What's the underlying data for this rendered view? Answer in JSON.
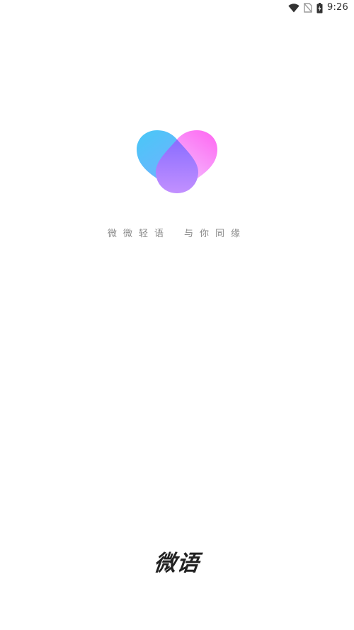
{
  "status_bar": {
    "time": "9:26",
    "icons": [
      "wifi-icon",
      "no-sim-icon",
      "battery-charging-icon"
    ]
  },
  "logo": {
    "icon": "heart-droplet-logo",
    "colors": {
      "left_drop_top": "#4ec6f5",
      "left_drop_bottom": "#7aa8ff",
      "right_drop_top": "#ff6ef0",
      "right_drop_bottom": "#e6a6ff",
      "center_drop_top": "#8f7bff",
      "center_drop_bottom": "#c58dff"
    }
  },
  "slogan": {
    "part1": "微微轻语",
    "part2": "与你同缘"
  },
  "brand": {
    "name": "微语"
  }
}
